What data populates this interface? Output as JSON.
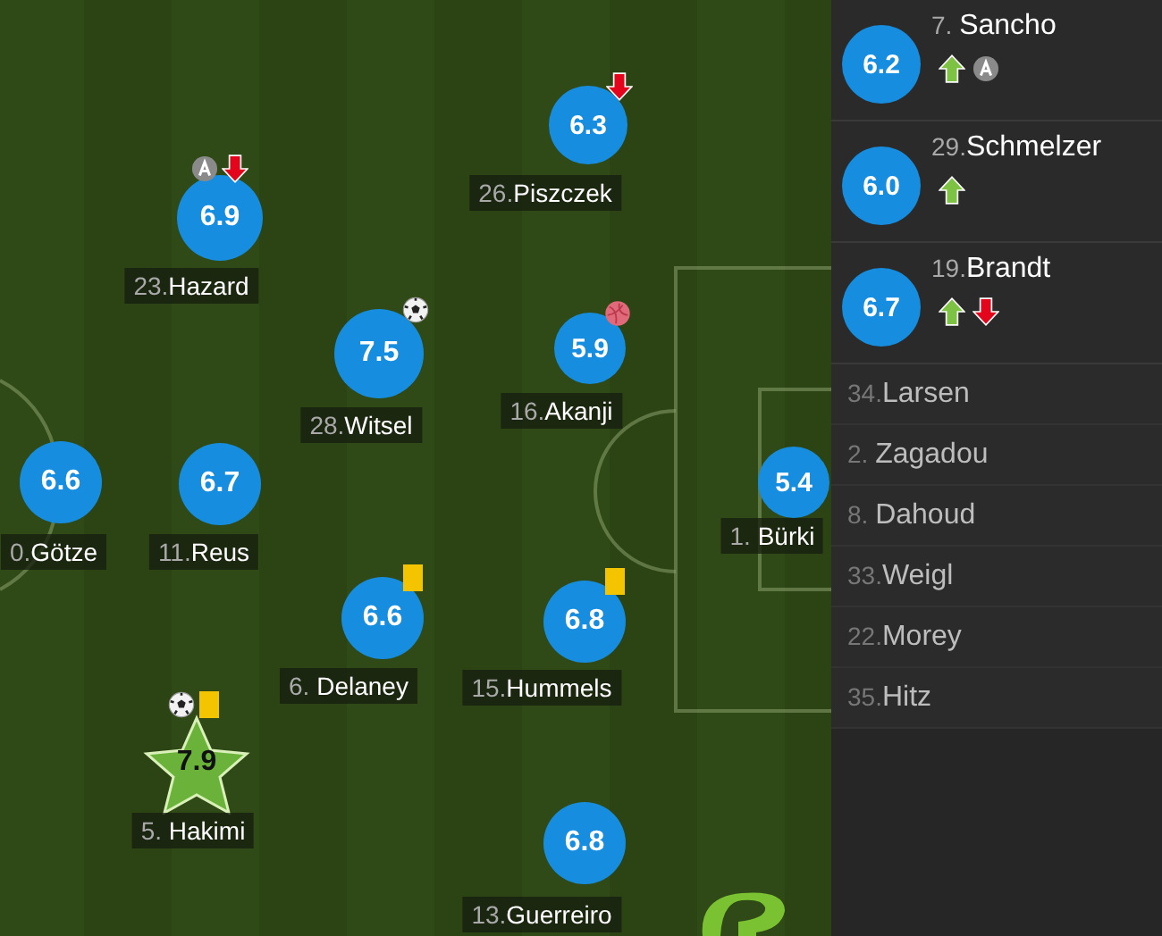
{
  "pitch_players": [
    {
      "kind": "circle",
      "number": "26.",
      "name": "Piszczek",
      "rating": "6.3",
      "events": [
        {
          "kind": "sub_out"
        }
      ]
    },
    {
      "kind": "circle",
      "number": "23.",
      "name": "Hazard",
      "rating": "6.9",
      "events": [
        {
          "kind": "assist"
        },
        {
          "kind": "sub_out"
        }
      ]
    },
    {
      "kind": "circle",
      "number": "28.",
      "name": "Witsel",
      "rating": "7.5",
      "events": [
        {
          "kind": "goal"
        }
      ]
    },
    {
      "kind": "circle",
      "number": "16.",
      "name": "Akanji",
      "rating": "5.9",
      "events": [
        {
          "kind": "own_goal"
        }
      ]
    },
    {
      "kind": "circle",
      "number": "0.",
      "name": "Götze",
      "rating": "6.6"
    },
    {
      "kind": "circle",
      "number": "11.",
      "name": "Reus",
      "rating": "6.7"
    },
    {
      "kind": "circle",
      "number": "1. ",
      "name": "Bürki",
      "rating": "5.4"
    },
    {
      "kind": "circle",
      "number": "6. ",
      "name": "Delaney",
      "rating": "6.6",
      "events": [
        {
          "kind": "yellow_card"
        }
      ]
    },
    {
      "kind": "circle",
      "number": "15.",
      "name": "Hummels",
      "rating": "6.8",
      "events": [
        {
          "kind": "yellow_card"
        }
      ]
    },
    {
      "kind": "star",
      "number": "5. ",
      "name": "Hakimi",
      "rating": "7.9",
      "events": [
        {
          "kind": "goal"
        },
        {
          "kind": "yellow_card"
        }
      ]
    },
    {
      "kind": "circle",
      "number": "13.",
      "name": "Guerreiro",
      "rating": "6.8"
    }
  ],
  "bench": [
    {
      "kind": "rated",
      "number": "7. ",
      "name": "Sancho",
      "rating": "6.2",
      "events": [
        {
          "kind": "sub_in"
        },
        {
          "kind": "assist"
        }
      ]
    },
    {
      "kind": "rated",
      "number": "29.",
      "name": "Schmelzer",
      "rating": "6.0",
      "events": [
        {
          "kind": "sub_in"
        }
      ]
    },
    {
      "kind": "rated",
      "number": "19.",
      "name": "Brandt",
      "rating": "6.7",
      "events": [
        {
          "kind": "sub_in"
        },
        {
          "kind": "sub_out"
        }
      ]
    },
    {
      "kind": "unused",
      "number": "34.",
      "name": "Larsen"
    },
    {
      "kind": "unused",
      "number": "2. ",
      "name": "Zagadou"
    },
    {
      "kind": "unused",
      "number": "8. ",
      "name": "Dahoud"
    },
    {
      "kind": "unused",
      "number": "33.",
      "name": "Weigl"
    },
    {
      "kind": "unused",
      "number": "22.",
      "name": "Morey"
    },
    {
      "kind": "unused",
      "number": "35.",
      "name": "Hitz"
    }
  ]
}
